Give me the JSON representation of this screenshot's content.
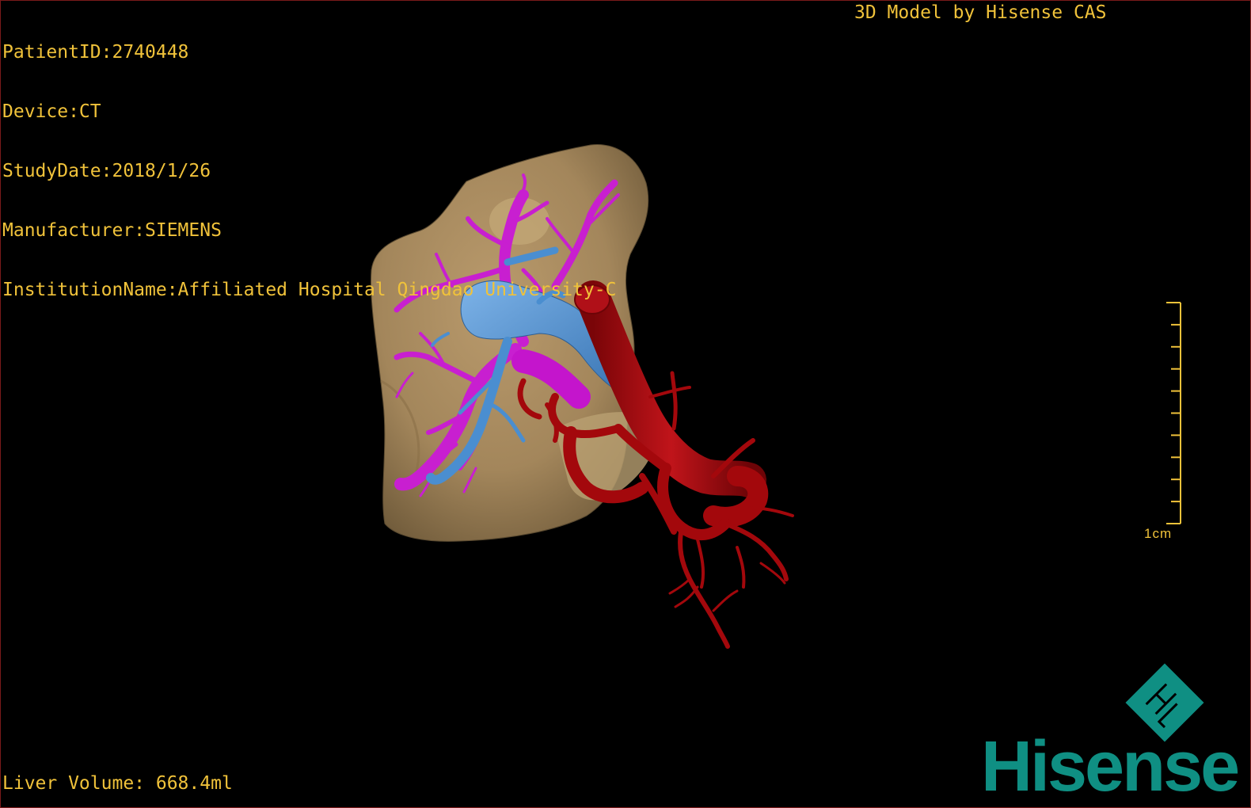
{
  "header": {
    "patient_id": "PatientID:2740448",
    "device": "Device:CT",
    "study_date": "StudyDate:2018/1/26",
    "manufacturer": "Manufacturer:SIEMENS",
    "institution": "InstitutionName:Affiliated Hospital Qingdao University-C",
    "model_credit": "3D Model by Hisense CAS"
  },
  "footer": {
    "liver_volume": "Liver Volume: 668.4ml"
  },
  "scale_bar": {
    "label": "1cm",
    "tick_count": 10
  },
  "logo": {
    "brand": "Hisense",
    "mark_icon": "hisense-diamond-logo-icon"
  },
  "colors": {
    "overlay_text": "#f0c23a",
    "liver": "#a88a5e",
    "hepatic_vein": "#c81fd0",
    "portal_vein": "#4a8ed0",
    "artery": "#a3080c",
    "brand": "#0f8f83"
  },
  "structures": [
    "liver-surface",
    "hepatic-vein-tree",
    "portal-vein",
    "arterial-tree"
  ]
}
